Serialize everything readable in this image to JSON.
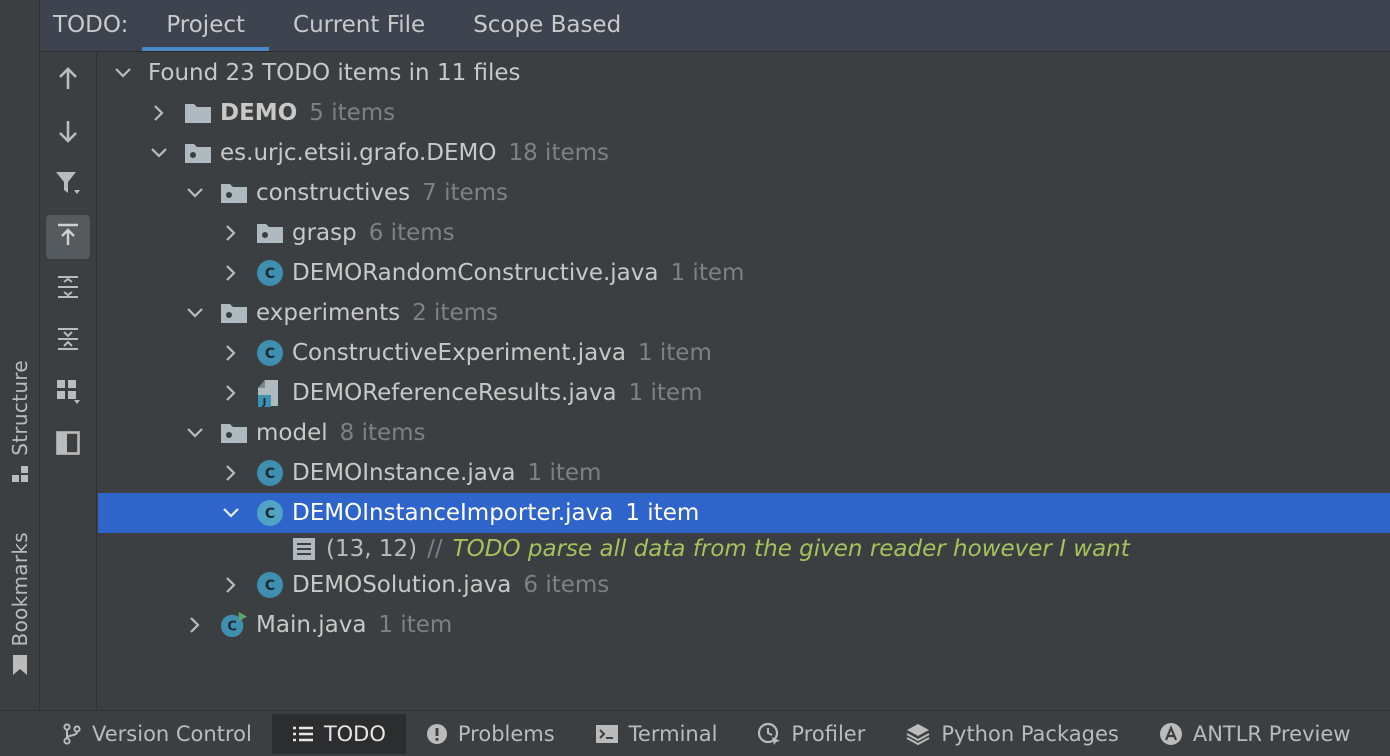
{
  "left_strip": {
    "structure_label": "Structure",
    "bookmarks_label": "Bookmarks"
  },
  "header": {
    "title": "TODO:",
    "tabs": [
      {
        "label": "Project",
        "active": true
      },
      {
        "label": "Current File",
        "active": false
      },
      {
        "label": "Scope Based",
        "active": false
      }
    ]
  },
  "toolbar": {
    "icons": [
      "arrow-up-icon",
      "arrow-down-icon",
      "filter-icon",
      "autoscroll-icon",
      "expand-all-icon",
      "collapse-all-icon",
      "group-by-icon",
      "preview-pane-icon"
    ]
  },
  "tree": {
    "summary": "Found 23 TODO items in 11 files",
    "nodes": [
      {
        "name": "DEMO",
        "count": "5 items",
        "icon": "folder-icon"
      },
      {
        "name": "es.urjc.etsii.grafo.DEMO",
        "count": "18 items",
        "icon": "package-icon"
      },
      {
        "name": "constructives",
        "count": "7 items",
        "icon": "package-icon"
      },
      {
        "name": "grasp",
        "count": "6 items",
        "icon": "package-icon"
      },
      {
        "name": "DEMORandomConstructive.java",
        "count": "1 item",
        "icon": "java-class-icon"
      },
      {
        "name": "experiments",
        "count": "2 items",
        "icon": "package-icon"
      },
      {
        "name": "ConstructiveExperiment.java",
        "count": "1 item",
        "icon": "java-class-icon"
      },
      {
        "name": "DEMOReferenceResults.java",
        "count": "1 item",
        "icon": "java-file-icon"
      },
      {
        "name": "model",
        "count": "8 items",
        "icon": "package-icon"
      },
      {
        "name": "DEMOInstance.java",
        "count": "1 item",
        "icon": "java-class-icon"
      },
      {
        "name": "DEMOInstanceImporter.java",
        "count": "1 item",
        "icon": "java-class-icon"
      },
      {
        "name": "DEMOSolution.java",
        "count": "6 items",
        "icon": "java-class-icon"
      },
      {
        "name": "Main.java",
        "count": "1 item",
        "icon": "java-main-class-icon"
      }
    ],
    "todo_item": {
      "position": "(13, 12)",
      "comment_prefix": "//",
      "text": "TODO parse all data from the given reader however I want"
    }
  },
  "bottom_bar": {
    "tabs": [
      {
        "label": "Version Control",
        "icon": "branch-icon",
        "active": false
      },
      {
        "label": "TODO",
        "icon": "list-icon",
        "active": true
      },
      {
        "label": "Problems",
        "icon": "problems-icon",
        "active": false
      },
      {
        "label": "Terminal",
        "icon": "terminal-icon",
        "active": false
      },
      {
        "label": "Profiler",
        "icon": "profiler-icon",
        "active": false
      },
      {
        "label": "Python Packages",
        "icon": "layers-icon",
        "active": false
      },
      {
        "label": "ANTLR Preview",
        "icon": "antlr-icon",
        "active": false
      }
    ]
  },
  "colors": {
    "background": "#3c3f41",
    "selection": "#2f65ca",
    "todo_text": "#a5c25c",
    "active_tab_underline": "#4a88c7",
    "java_class": "#3f8fb0"
  }
}
